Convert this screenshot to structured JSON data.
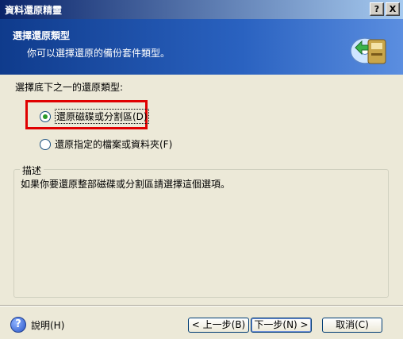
{
  "window": {
    "title": "資料還原精靈",
    "help_button": "?",
    "close_button": "X"
  },
  "header": {
    "title": "選擇還原類型",
    "subtitle": "你可以選擇還原的備份套件類型。"
  },
  "prompt": "選擇底下之一的還原類型:",
  "options": [
    {
      "label": "還原磁碟或分割區(D)",
      "selected": true
    },
    {
      "label": "還原指定的檔案或資料夾(F)",
      "selected": false
    }
  ],
  "description": {
    "legend": "描述",
    "text": "如果你要還原整部磁碟或分割區請選擇這個選項。"
  },
  "footer": {
    "help_label": "說明(H)",
    "back_label": "< 上一步(B)",
    "next_label": "下一步(N) >",
    "cancel_label": "取消(C)"
  },
  "colors": {
    "highlight": "#e00000",
    "header_bg": "#2a62c0",
    "radio_dot": "#2a9a2a"
  }
}
